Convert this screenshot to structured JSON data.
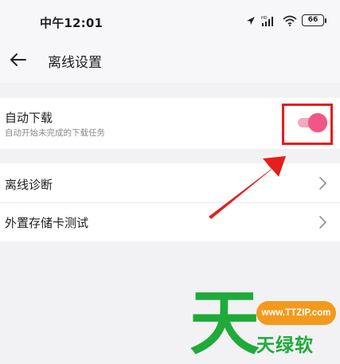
{
  "status_bar": {
    "time": "中午12:01",
    "battery": "66"
  },
  "header": {
    "title": "离线设置"
  },
  "settings": {
    "auto_download": {
      "title": "自动下载",
      "subtitle": "自动开始未完成的下载任务",
      "enabled": true
    },
    "items": [
      {
        "label": "离线诊断"
      },
      {
        "label": "外置存储卡测试"
      }
    ]
  },
  "colors": {
    "accent": "#f25587",
    "highlight": "#e81d1d",
    "watermark_green": "#1faa3a",
    "watermark_orange": "#f39a1d"
  },
  "watermark": {
    "char": "天",
    "url": "www.TTZIP.com",
    "text": "天绿软"
  }
}
